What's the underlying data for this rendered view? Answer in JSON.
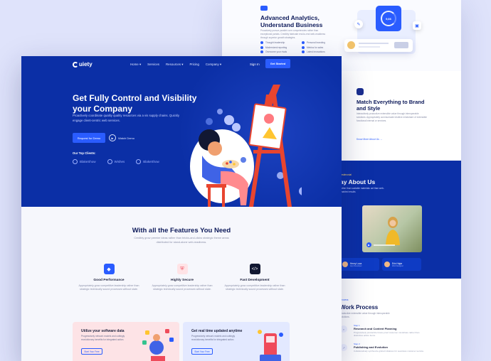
{
  "colors": {
    "brand_blue": "#0b2fa6",
    "accent_blue": "#2a5cff",
    "page_bg": "#dfe3fb"
  },
  "right_page": {
    "analytics": {
      "title": "Advanced Analytics, Understand Business",
      "desc": "Proactively pursue parallel core competencies rather than exceptional portals. Credibly fabricate end-to-end web-readiness through superior growth strategies.",
      "bullets": [
        "Thought leadership",
        "Personal branding",
        "Modernized reporting",
        "Metrics for sales",
        "Overcome your rivals",
        "Latest innovations"
      ],
      "gauge_value": "9,66"
    },
    "brand": {
      "title": "Match Everything to Brand and Style",
      "desc": "Interactively productize extensible value through interoperable solutions. Appropriately communicate intuitive mindshare of extensible functional internal or services.",
      "link": "Know More About Us"
    },
    "about": {
      "eyebrow": "Testimonial",
      "title": "ay About Us",
      "desc": "rather than scalable materials uct than web-enabled results",
      "testimonials": [
        {
          "name": "Henry Luca",
          "role": "App Developer"
        },
        {
          "name": "Erin Hajar",
          "role": "Web Designer"
        }
      ]
    },
    "work": {
      "eyebrow": "Process",
      "title": "Work Process",
      "desc": "productize extensible value through interoperable solutions.",
      "steps": [
        {
          "num": "Step 1",
          "title": "Research and Content Planning",
          "desc": "Progressively productize future-proof customer mindshare rather than distinctive action items."
        },
        {
          "num": "Step 2",
          "title": "Publishing and Evolution",
          "desc": "Collaboratively synthesize global initiatives for seamless customer service."
        }
      ]
    }
  },
  "main_page": {
    "logo": "uiety",
    "nav": [
      "Home",
      "Services",
      "Resources",
      "Pricing",
      "Company"
    ],
    "signin": "Sign In",
    "cta": "Get Started",
    "hero": {
      "title": "Get Fully Control and Visibility your Company",
      "desc": "Proactively coordinate quality quality resources via a vis supply chains. Quickly engage client-centric web services.",
      "primary": "Request for Demo",
      "secondary": "Watch Demo",
      "clients_label": "Our Top Clients:",
      "clients": [
        "BlakeShow",
        "Wishes",
        "BlakeShow"
      ]
    },
    "features": {
      "title": "With all the Features You Need",
      "subtitle": "Credibly grow premier ideas rather than bricks-and-clicks strategic theme areas distributed for stand-alone web-readiness.",
      "items": [
        {
          "title": "Good Performance",
          "desc": "Appropriately grow competitive leadership rather than strategic technically sound processes without state."
        },
        {
          "title": "Highly Secure",
          "desc": "Appropriately grow competitive leadership rather than strategic technically sound processes without state."
        },
        {
          "title": "Fast Development",
          "desc": "Appropriately grow competitive leadership rather than strategic technically sound processes without state."
        }
      ]
    },
    "promos": [
      {
        "title": "Utilize your software data",
        "desc": "Progressively network models and cuttingly revolutionary benefits for integrated action.",
        "button": "Start Your Free"
      },
      {
        "title": "Get real time updated anytime",
        "desc": "Progressively network models and cuttingly revolutionary benefits for integrated action.",
        "button": "Start Your Free"
      }
    ]
  }
}
